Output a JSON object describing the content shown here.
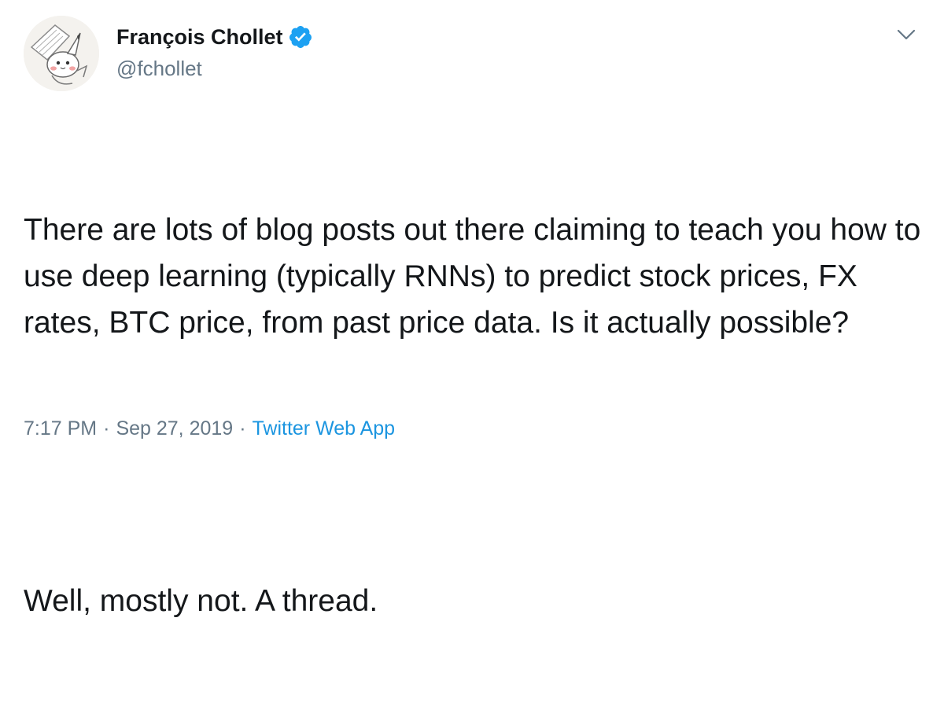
{
  "author": {
    "display_name": "François Chollet",
    "handle": "@fchollet",
    "verified_icon": "verified-badge-icon",
    "avatar_icon": "avatar-illustration"
  },
  "tweet": {
    "paragraph_1": "There are lots of blog posts out there claiming to teach you how to use deep learning (typically RNNs) to predict stock prices, FX rates, BTC price, from past price data. Is it actually possible?",
    "paragraph_2": "Well, mostly not. A thread."
  },
  "meta": {
    "time": "7:17 PM",
    "separator": "·",
    "date": "Sep 27, 2019",
    "source": "Twitter Web App"
  },
  "colors": {
    "text": "#14171a",
    "secondary": "#657786",
    "link": "#1b95e0",
    "verified": "#1da1f2"
  },
  "icons": {
    "caret": "chevron-down-icon"
  }
}
